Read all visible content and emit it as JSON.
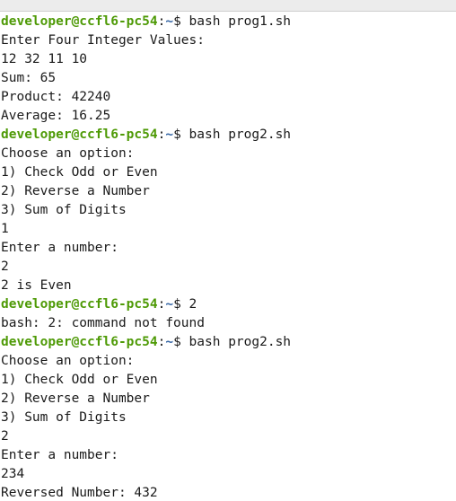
{
  "terminal": {
    "colors": {
      "prompt_user": "#4e9a06",
      "prompt_path": "#3465a4",
      "text": "#1a1a1a",
      "background": "#ffffff"
    },
    "prompt": {
      "user_host": "developer@ccfl6-pc54",
      "colon": ":",
      "path": "~",
      "symbol": "$ "
    },
    "lines": [
      {
        "type": "prompt",
        "command": "bash prog1.sh"
      },
      {
        "type": "output",
        "text": "Enter Four Integer Values:"
      },
      {
        "type": "output",
        "text": "12 32 11 10"
      },
      {
        "type": "output",
        "text": "Sum: 65"
      },
      {
        "type": "output",
        "text": "Product: 42240"
      },
      {
        "type": "output",
        "text": "Average: 16.25"
      },
      {
        "type": "prompt",
        "command": "bash prog2.sh"
      },
      {
        "type": "output",
        "text": "Choose an option:"
      },
      {
        "type": "output",
        "text": "1) Check Odd or Even"
      },
      {
        "type": "output",
        "text": "2) Reverse a Number"
      },
      {
        "type": "output",
        "text": "3) Sum of Digits"
      },
      {
        "type": "output",
        "text": "1"
      },
      {
        "type": "output",
        "text": "Enter a number:"
      },
      {
        "type": "output",
        "text": "2"
      },
      {
        "type": "output",
        "text": "2 is Even"
      },
      {
        "type": "prompt",
        "command": "2"
      },
      {
        "type": "output",
        "text": "bash: 2: command not found"
      },
      {
        "type": "prompt",
        "command": "bash prog2.sh"
      },
      {
        "type": "output",
        "text": "Choose an option:"
      },
      {
        "type": "output",
        "text": "1) Check Odd or Even"
      },
      {
        "type": "output",
        "text": "2) Reverse a Number"
      },
      {
        "type": "output",
        "text": "3) Sum of Digits"
      },
      {
        "type": "output",
        "text": "2"
      },
      {
        "type": "output",
        "text": "Enter a number:"
      },
      {
        "type": "output",
        "text": "234"
      },
      {
        "type": "output",
        "text": "Reversed Number: 432"
      }
    ]
  }
}
